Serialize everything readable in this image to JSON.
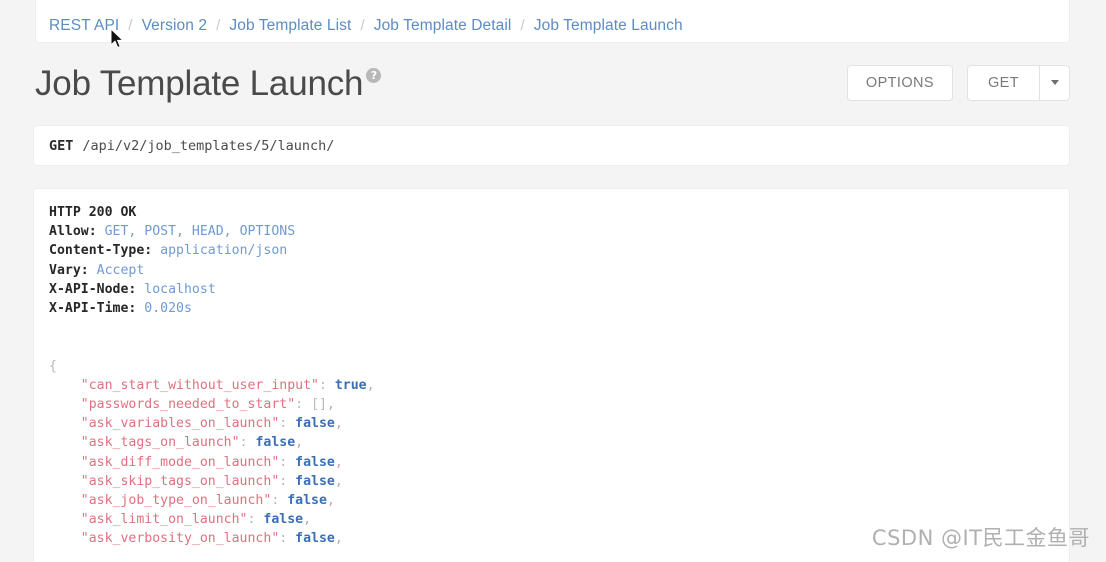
{
  "breadcrumb": {
    "separator": "/",
    "items": [
      {
        "label": "REST API"
      },
      {
        "label": "Version 2"
      },
      {
        "label": "Job Template List"
      },
      {
        "label": "Job Template Detail"
      },
      {
        "label": "Job Template Launch"
      }
    ]
  },
  "header": {
    "title": "Job Template Launch",
    "help_glyph": "?",
    "options_label": "OPTIONS",
    "get_label": "GET"
  },
  "request": {
    "method": "GET",
    "path": "/api/v2/job_templates/5/launch/"
  },
  "response": {
    "status_line": "HTTP 200 OK",
    "headers": [
      {
        "name": "Allow:",
        "value": "GET, POST, HEAD, OPTIONS"
      },
      {
        "name": "Content-Type:",
        "value": "application/json"
      },
      {
        "name": "Vary:",
        "value": "Accept"
      },
      {
        "name": "X-API-Node:",
        "value": "localhost"
      },
      {
        "name": "X-API-Time:",
        "value": "0.020s"
      }
    ],
    "body_open_brace": "{",
    "body_lines": [
      {
        "key": "\"can_start_without_user_input\"",
        "value": "true",
        "value_type": "bool",
        "trailing": ","
      },
      {
        "key": "\"passwords_needed_to_start\"",
        "value": "[]",
        "value_type": "array",
        "trailing": ","
      },
      {
        "key": "\"ask_variables_on_launch\"",
        "value": "false",
        "value_type": "bool",
        "trailing": ","
      },
      {
        "key": "\"ask_tags_on_launch\"",
        "value": "false",
        "value_type": "bool",
        "trailing": ","
      },
      {
        "key": "\"ask_diff_mode_on_launch\"",
        "value": "false",
        "value_type": "bool",
        "trailing": ","
      },
      {
        "key": "\"ask_skip_tags_on_launch\"",
        "value": "false",
        "value_type": "bool",
        "trailing": ","
      },
      {
        "key": "\"ask_job_type_on_launch\"",
        "value": "false",
        "value_type": "bool",
        "trailing": ","
      },
      {
        "key": "\"ask_limit_on_launch\"",
        "value": "false",
        "value_type": "bool",
        "trailing": ","
      },
      {
        "key": "\"ask_verbosity_on_launch\"",
        "value": "false",
        "value_type": "bool",
        "trailing": ","
      }
    ]
  },
  "watermark": {
    "text": "CSDN @IT民工金鱼哥"
  },
  "colors": {
    "link": "#5c8cc4",
    "page_background": "#f4f4f4",
    "panel_background": "#ffffff",
    "json_key": "#e0707f",
    "json_bool": "#3b6fb5",
    "header_value": "#6f9ad4"
  }
}
